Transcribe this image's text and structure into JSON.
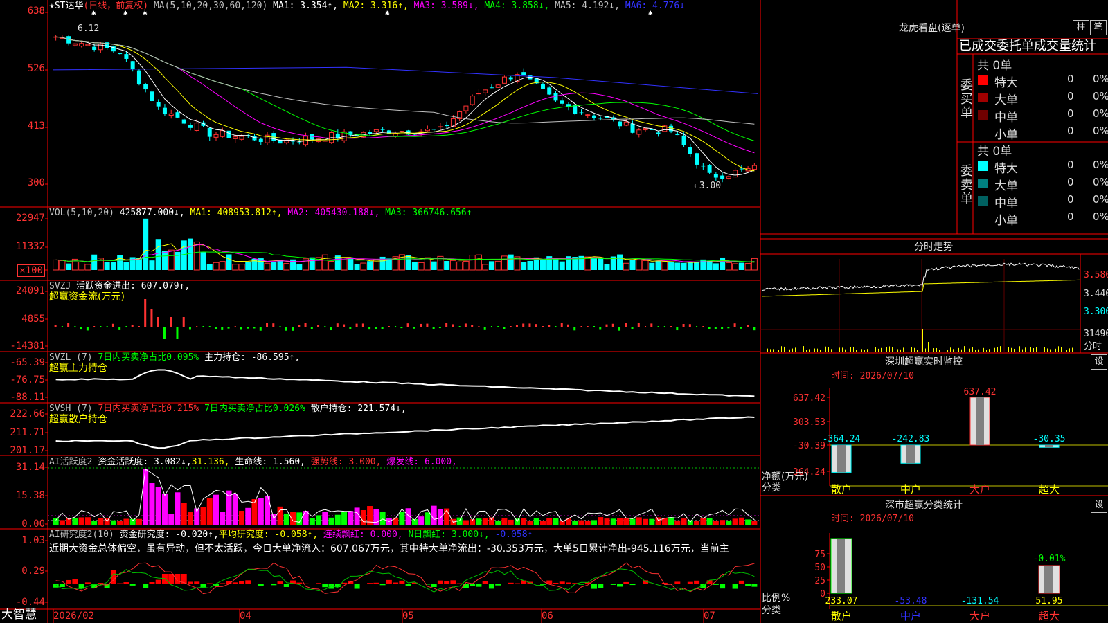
{
  "app": {
    "name": "大智慧"
  },
  "colors": {
    "up": "#ff3232",
    "down": "#00ffff",
    "grid": "#ff0000",
    "yellow": "#ffff00",
    "magenta": "#ff00ff",
    "green": "#00ff00",
    "white": "#ffffff",
    "blue": "#3232ff"
  },
  "kline": {
    "legend": {
      "name": "★ST达华",
      "mode": "(日线，前复权)",
      "ma_label": "MA(5,10,20,30,60,120)",
      "ma1": "MA1: 3.354↑,",
      "ma2": "MA2: 3.316↑,",
      "ma3": "MA3: 3.589↓,",
      "ma4": "MA4: 3.858↓,",
      "ma5": "MA5: 4.192↓,",
      "ma6": "MA6: 4.776↓"
    },
    "y_ticks": [
      "638",
      "526",
      "413",
      "300"
    ],
    "high_label": "6.12",
    "low_label": "←3.00",
    "x_labels": [
      "2026/02",
      "04",
      "05",
      "06",
      "07"
    ]
  },
  "volume": {
    "legend": {
      "name": "VOL(5,10,20)",
      "v": "425877.000↓,",
      "ma1": "MA1: 408953.812↑,",
      "ma2": "MA2: 405430.188↓,",
      "ma3": "MA3: 366746.656↑"
    },
    "y_ticks": [
      "22947",
      "11332",
      "×100"
    ]
  },
  "svzj": {
    "legend": {
      "name": "SVZJ",
      "label": "活跃资金进出: 607.079↑,",
      "sub": "超赢资金流(万元)"
    },
    "y_ticks": [
      "24091",
      "4855",
      "-14381"
    ]
  },
  "svzl": {
    "legend": {
      "name": "SVZL (7)",
      "a": "7日内买卖净占比0.095%",
      "b": "主力持仓: -86.595↑,",
      "sub": "超赢主力持仓"
    },
    "y_ticks": [
      "-65.39",
      "-76.75",
      "-88.11"
    ]
  },
  "svsh": {
    "legend": {
      "name": "SVSH (7)",
      "a": "7日内买卖净占比0.215%",
      "b": "7日内买卖净占比0.026%",
      "c": "散户持仓: 221.574↓,",
      "sub": "超赢散户持仓"
    },
    "y_ticks": [
      "222.66",
      "211.71",
      "201.17"
    ]
  },
  "ai_active": {
    "legend": {
      "name": "AI活跃度2",
      "a": "资金活跃度: 3.082↓,",
      "b": "31.136,",
      "c": "生命线: 1.560,",
      "d": "强势线: 3.000,",
      "e": "爆发线: 6.000,"
    },
    "y_ticks": [
      "31.14",
      "15.38",
      "0.00"
    ]
  },
  "ai_research": {
    "legend": {
      "name": "AI研究度2(10)",
      "a": "资金研究度: -0.020↑,",
      "b": "平均研究度: -0.058↑,",
      "c": "连续飘红: 0.000,",
      "d": "N日飘红: 3.000↓,",
      "e": "-0.058↑"
    },
    "comment": "近期大资金总体偏空，虽有异动，但不太活跃，今日大单净流入：607.067万元，其中特大单净流出：-30.353万元，大单5日累计净出-945.116万元，当前主",
    "y_ticks": [
      "1.03",
      "0.29",
      "-0.44"
    ]
  },
  "longhu": {
    "title": "龙虎看盘(逐单)",
    "btn1": "柱",
    "btn2": "笔",
    "tabs": "已成交委托单成交量统计",
    "buy": {
      "label": "委买单",
      "total": "共 0单",
      "rows": [
        {
          "name": "特大",
          "count": "0",
          "pct": "0%",
          "color": "#ff0000"
        },
        {
          "name": "大单",
          "count": "0",
          "pct": "0%",
          "color": "#a00000"
        },
        {
          "name": "中单",
          "count": "0",
          "pct": "0%",
          "color": "#700000"
        },
        {
          "name": "小单",
          "count": "0",
          "pct": "0%",
          "color": ""
        }
      ]
    },
    "sell": {
      "label": "委卖单",
      "total": "共 0单",
      "rows": [
        {
          "name": "特大",
          "count": "0",
          "pct": "0%",
          "color": "#00ffff"
        },
        {
          "name": "大单",
          "count": "0",
          "pct": "0%",
          "color": "#008080"
        },
        {
          "name": "中单",
          "count": "0",
          "pct": "0%",
          "color": "#006060"
        },
        {
          "name": "小单",
          "count": "0",
          "pct": "0%",
          "color": ""
        }
      ]
    }
  },
  "intraday": {
    "title": "分时走势",
    "prices": [
      "3.580",
      "3.440",
      "3.300"
    ],
    "vol_label": "31490",
    "unit": "分时"
  },
  "realtime": {
    "title": "深圳超赢实时监控",
    "btn": "设",
    "time": "时间: 2026/07/10",
    "y_ticks": [
      "637.42",
      "303.53",
      "-30.39",
      "-364.24"
    ],
    "ylabel1": "净额(万元)",
    "ylabel2": "分类",
    "categories": [
      "散户",
      "中户",
      "大户",
      "超大"
    ],
    "values": [
      -364.24,
      -242.83,
      637.42,
      -30.35
    ],
    "value_labels": [
      "-364.24",
      "-242.83",
      "637.42",
      "-30.35"
    ]
  },
  "classstat": {
    "title": "深市超赢分类统计",
    "btn": "设",
    "time": "时间: 2026/07/10",
    "y_ticks": [
      "75",
      "50",
      "25",
      "0"
    ],
    "ylabel1": "比例%",
    "ylabel2": "分类",
    "categories": [
      "散户",
      "中户",
      "大户",
      "超大"
    ],
    "values": [
      233.07,
      -53.48,
      -131.54,
      51.95
    ],
    "value_labels": [
      "233.07",
      "-53.48",
      "-131.54",
      "51.95"
    ],
    "top_label": "-0.01%"
  }
}
